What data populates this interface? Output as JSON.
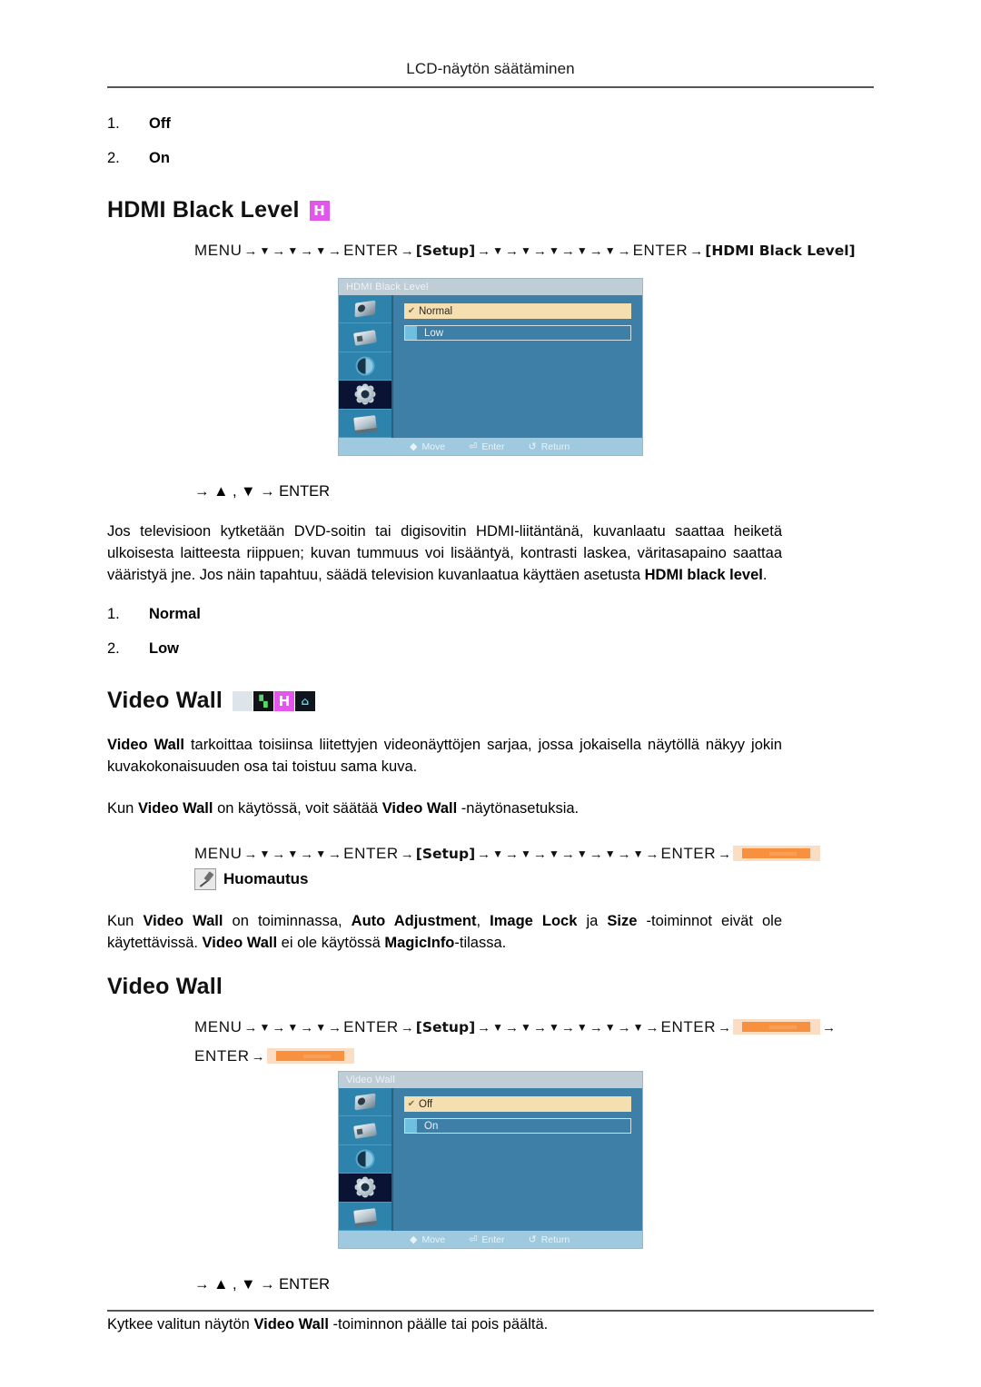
{
  "running_head": "LCD-näytön säätäminen",
  "top_list": [
    {
      "num": "1.",
      "label": "Off"
    },
    {
      "num": "2.",
      "label": "On"
    }
  ],
  "hdmi_section": {
    "heading": "HDMI Black Level",
    "badge": "H",
    "menu_path": {
      "menu": "MENU",
      "enter": "ENTER",
      "setup": "[Setup]",
      "target": "[HDMI Black Level]",
      "arrow": "→",
      "down": "▼"
    },
    "osd": {
      "title": "HDMI Black Level",
      "options": [
        {
          "label": "Normal",
          "selected": true
        },
        {
          "label": "Low",
          "selected": false
        }
      ],
      "footer": [
        {
          "icon": "updown-icon",
          "glyph": "◆",
          "label": "Move"
        },
        {
          "icon": "enter-key-icon",
          "glyph": "⏎",
          "label": "Enter"
        },
        {
          "icon": "return-icon",
          "glyph": "↺",
          "label": "Return"
        }
      ],
      "sidebar_icons": [
        "picture-icon",
        "card-icon",
        "contrast-icon",
        "gear-icon",
        "screen-icon"
      ],
      "selected_sidebar_index": 3
    },
    "key_hint": "→ ▲ , ▼ → ENTER",
    "paragraph": "Jos televisioon kytketään DVD-soitin tai digisovitin HDMI-liitäntänä, kuvanlaatu saattaa heiketä ulkoisesta laitteesta riippuen; kuvan tummuus voi lisääntyä, kontrasti laskea, väritasapaino saattaa vääristyä jne. Jos näin tapahtuu, säädä television kuvanlaatua käyttäen asetusta ",
    "paragraph_bold": "HDMI black level",
    "paragraph_end": ".",
    "list": [
      {
        "num": "1.",
        "label": "Normal"
      },
      {
        "num": "2.",
        "label": "Low"
      }
    ]
  },
  "videowall_section": {
    "heading": "Video Wall",
    "badges": [
      "gray",
      "green-glyph",
      "H",
      "cyan-glyph"
    ],
    "badge_h": "H",
    "para1_bold": "Video Wall",
    "para1": " tarkoittaa toisiinsa liitettyjen videonäyttöjen sarjaa, jossa jokaisella näytöllä näkyy jokin kuvakokonaisuuden osa tai toistuu sama kuva.",
    "para2_pre": "Kun ",
    "para2_b1": "Video Wall",
    "para2_mid": " on käytössä, voit säätää ",
    "para2_b2": "Video Wall",
    "para2_end": " -näytönasetuksia.",
    "note_label": "Huomautus",
    "note_pre": "Kun ",
    "note_b1": "Video Wall",
    "note_m1": " on toiminnassa, ",
    "note_b2": "Auto Adjustment",
    "note_m2": ", ",
    "note_b3": "Image Lock",
    "note_m3": " ja ",
    "note_b4": "Size",
    "note_m4": " -toiminnot eivät ole käytettävissä. ",
    "note_b5": "Video Wall",
    "note_m5": " ei ole käytössä ",
    "note_b6": "MagicInfo",
    "note_m6": "-tilassa."
  },
  "videowall_sub": {
    "heading": "Video Wall",
    "osd": {
      "title": "Video Wall",
      "options": [
        {
          "label": "Off",
          "selected": true
        },
        {
          "label": "On",
          "selected": false
        }
      ],
      "footer": [
        {
          "icon": "updown-icon",
          "glyph": "◆",
          "label": "Move"
        },
        {
          "icon": "enter-key-icon",
          "glyph": "⏎",
          "label": "Enter"
        },
        {
          "icon": "return-icon",
          "glyph": "↺",
          "label": "Return"
        }
      ],
      "selected_sidebar_index": 3
    },
    "key_hint": "→ ▲ , ▼ → ENTER",
    "closing_pre": "Kytkee valitun näytön ",
    "closing_bold": "Video Wall",
    "closing_end": " -toiminnon päälle tai pois päältä."
  },
  "colors": {
    "osd_bg": "#3e7fa8",
    "osd_selected_row": "#f5dfb0",
    "badge_magenta": "#e455ee",
    "redaction_orange": "#f7913f",
    "rule": "#555555"
  }
}
